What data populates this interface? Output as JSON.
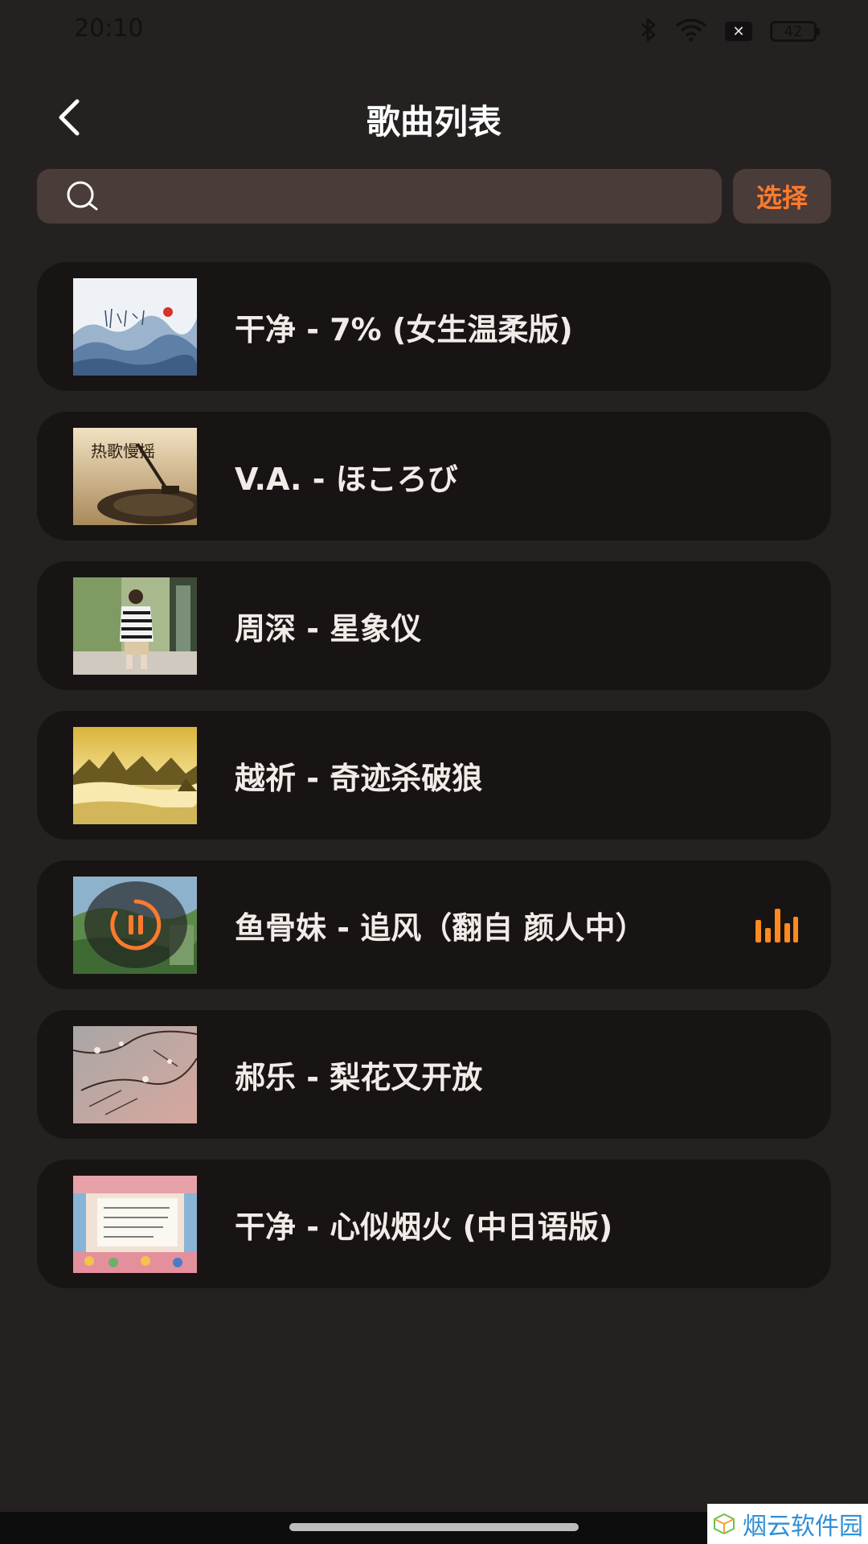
{
  "status_bar": {
    "time": "20:10",
    "battery": "42",
    "sim": "✕"
  },
  "header": {
    "title": "歌曲列表"
  },
  "search": {
    "value": "",
    "placeholder": ""
  },
  "select_button": {
    "label": "选择"
  },
  "songs": [
    {
      "title": "干净 - 7% (女生温柔版)",
      "playing": false
    },
    {
      "title": "V.A. - ほころび",
      "playing": false,
      "cover_text": "热歌慢摇"
    },
    {
      "title": "周深 - 星象仪",
      "playing": false
    },
    {
      "title": "越祈 - 奇迹杀破狼",
      "playing": false
    },
    {
      "title": "鱼骨妹 - 追风（翻自 颜人中）",
      "playing": true
    },
    {
      "title": "郝乐 - 梨花又开放",
      "playing": false
    },
    {
      "title": "干净 - 心似烟火 (中日语版)",
      "playing": false
    }
  ],
  "colors": {
    "background": "#252120",
    "card": "#171413",
    "search_bg": "#4a3c38",
    "accent": "#ff7a2e",
    "text": "#f2ece8"
  },
  "icons": {
    "back": "back-arrow-icon",
    "search": "search-icon",
    "playing": "equalizer-icon",
    "pause": "pause-icon",
    "bluetooth": "bluetooth-icon",
    "wifi": "wifi-icon"
  },
  "watermark": {
    "text": "烟云软件园"
  }
}
